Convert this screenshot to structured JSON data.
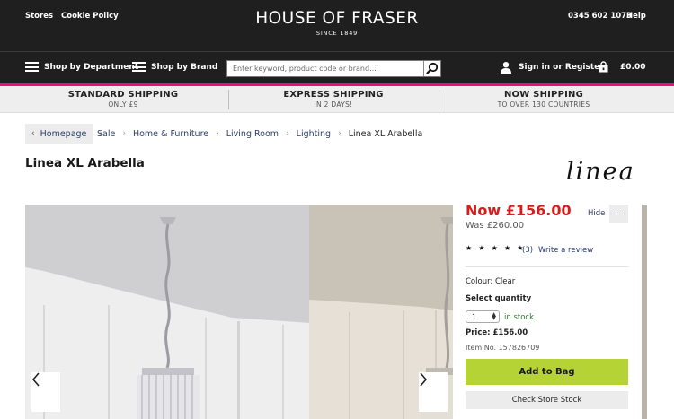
{
  "header": {
    "stores_label": "Stores",
    "cookie_label": "Cookie Policy",
    "brand_name": "HOUSE OF FRASER",
    "brand_since": "SINCE 1849",
    "phone": "0345 602 1073",
    "help_label": "Help"
  },
  "nav": {
    "shop_by_department": "Shop by Department",
    "shop_by_brand": "Shop by Brand",
    "search_placeholder": "Enter keyword, product code or brand...",
    "signin_label": "Sign in or Register",
    "bag_total": "£0.00"
  },
  "shipping": [
    {
      "title": "STANDARD SHIPPING",
      "subtitle": "ONLY £9"
    },
    {
      "title": "EXPRESS SHIPPING",
      "subtitle": "IN 2 DAYS!"
    },
    {
      "title": "NOW SHIPPING",
      "subtitle": "TO OVER 130 COUNTRIES"
    }
  ],
  "breadcrumb": {
    "home": "Homepage",
    "items": [
      "Sale",
      "Home & Furniture",
      "Living Room",
      "Lighting"
    ],
    "current": "Linea XL Arabella"
  },
  "product": {
    "title": "Linea XL Arabella",
    "brand_logo_text": "linea",
    "now_price": "Now £156.00",
    "was_price": "Was £260.00",
    "hide_label": "Hide",
    "stars": "★ ★ ★ ★ ★",
    "rating_fraction": 1.0,
    "review_count": "(3)",
    "write_review": "Write a review",
    "colour_line": "Colour: Clear",
    "select_quantity_label": "Select quantity",
    "quantity_value": "1",
    "stock_status": "in stock",
    "price_line": "Price: £156.00",
    "item_number": "Item No. 157826709",
    "add_to_bag": "Add to Bag",
    "check_store_stock": "Check Store Stock"
  },
  "colors": {
    "header_bg": "#1f1f1f",
    "accent_pink": "#e3127a",
    "price_red": "#d91b1b",
    "add_to_bag_green": "#b5d334",
    "link_navy": "#2a3d6b",
    "in_stock_green": "#2e7d32"
  }
}
